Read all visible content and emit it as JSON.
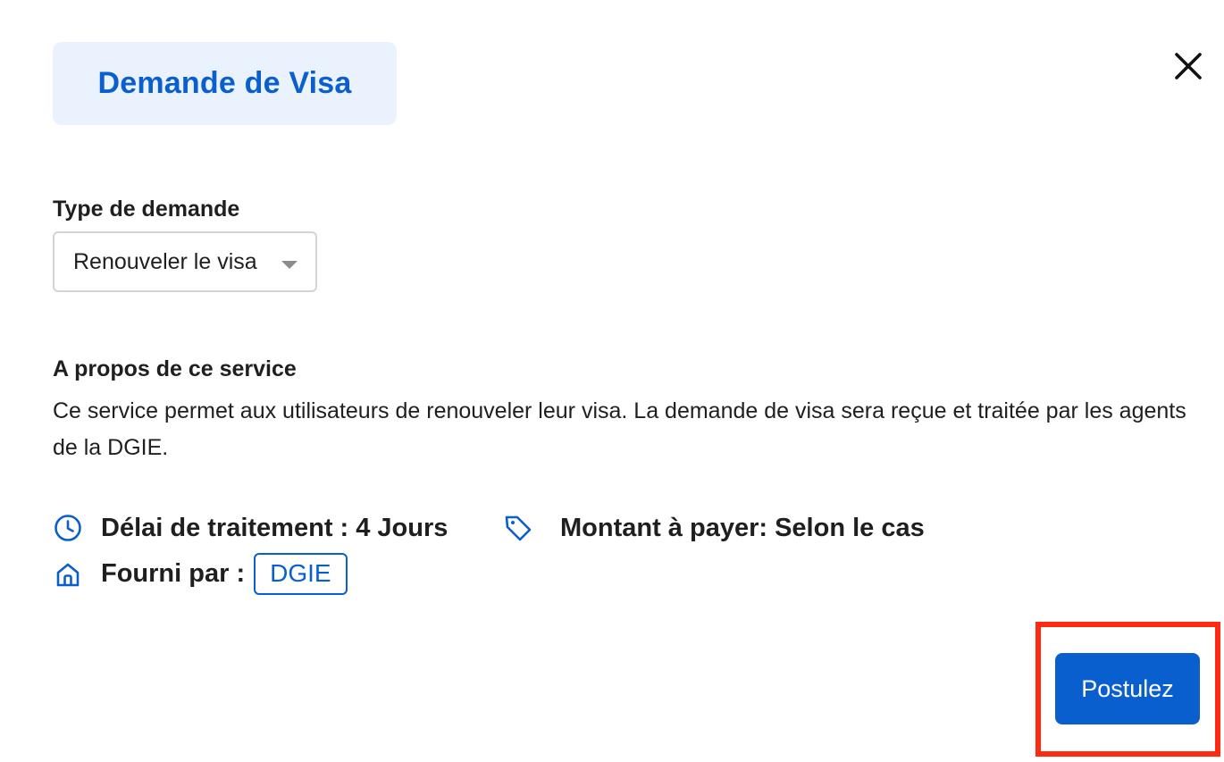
{
  "header": {
    "title": "Demande de Visa",
    "close_icon": "close-icon"
  },
  "form": {
    "request_type_label": "Type de demande",
    "request_type_value": "Renouveler le visa",
    "dropdown_icon": "caret-down-icon"
  },
  "about": {
    "title": "A propos de ce service",
    "description": "Ce service permet aux utilisateurs de renouveler leur visa. La demande de visa sera reçue et traitée par les agents de la DGIE."
  },
  "meta": {
    "processing_time": "Délai de traitement : 4 Jours",
    "amount": "Montant à payer: Selon le cas",
    "provided_by_label": "Fourni par :",
    "provider": "DGIE",
    "icons": [
      "clock-icon",
      "tag-icon",
      "home-icon"
    ]
  },
  "actions": {
    "apply_label": "Postulez"
  },
  "colors": {
    "accent": "#0a5fcf",
    "title_bg": "#eaf2fd",
    "highlight": "#ff2a12",
    "text": "#1f1f1f"
  }
}
